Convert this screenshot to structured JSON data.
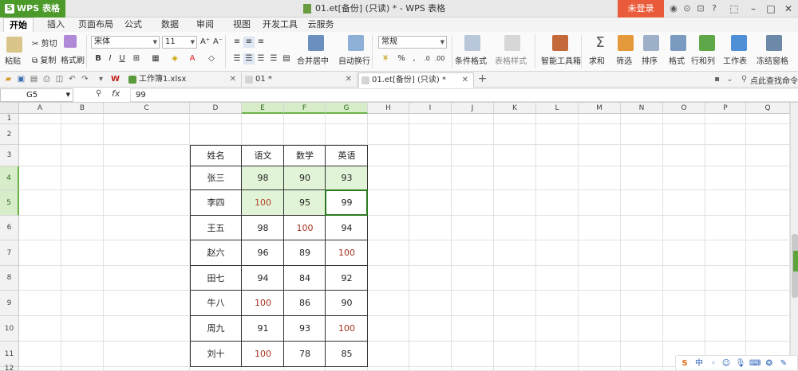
{
  "titlebar": {
    "app_name": "WPS 表格",
    "document_title": "01.et[备份] (只读) * - WPS 表格",
    "login_label": "未登录"
  },
  "menu_tabs": [
    "开始",
    "插入",
    "页面布局",
    "公式",
    "数据",
    "审阅",
    "视图",
    "开发工具",
    "云服务"
  ],
  "ribbon": {
    "cut": "剪切",
    "copy": "复制",
    "format_painter": "格式刷",
    "paste": "粘贴",
    "font_name": "宋体",
    "font_size": "11",
    "bold": "B",
    "italic": "I",
    "underline": "U",
    "merge_center": "合并居中",
    "wrap_text": "自动换行",
    "number_format": "常规",
    "percent": "%",
    "thousands": ",",
    "cond_format": "条件格式",
    "table_style": "表格样式",
    "smart_toolbox": "智能工具箱",
    "sum": "求和",
    "filter": "筛选",
    "sort": "排序",
    "format": "格式",
    "row_col": "行和列",
    "worksheet": "工作表",
    "freeze": "冻结窗格"
  },
  "doc_tabs": [
    {
      "label": "工作簿1.xlsx",
      "active": false
    },
    {
      "label": "01 *",
      "active": false
    },
    {
      "label": "01.et[备份] (只读) *",
      "active": true
    }
  ],
  "find_command": "点此查找命令",
  "formula_bar": {
    "cell_ref": "G5",
    "fx": "fx",
    "value": "99"
  },
  "columns": [
    "A",
    "B",
    "C",
    "D",
    "E",
    "F",
    "G",
    "H",
    "I",
    "J",
    "K",
    "L",
    "M",
    "N",
    "O",
    "P",
    "Q"
  ],
  "rows": [
    "1",
    "2",
    "3",
    "4",
    "5",
    "6",
    "7",
    "8",
    "9",
    "10",
    "11",
    "12"
  ],
  "table": {
    "headers": [
      "姓名",
      "语文",
      "数学",
      "英语"
    ],
    "records": [
      {
        "name": "张三",
        "chinese": "98",
        "math": "90",
        "english": "93"
      },
      {
        "name": "李四",
        "chinese": "100",
        "math": "95",
        "english": "99"
      },
      {
        "name": "王五",
        "chinese": "98",
        "math": "100",
        "english": "94"
      },
      {
        "name": "赵六",
        "chinese": "96",
        "math": "89",
        "english": "100"
      },
      {
        "name": "田七",
        "chinese": "94",
        "math": "84",
        "english": "92"
      },
      {
        "name": "牛八",
        "chinese": "100",
        "math": "86",
        "english": "90"
      },
      {
        "name": "周九",
        "chinese": "91",
        "math": "93",
        "english": "100"
      },
      {
        "name": "刘十",
        "chinese": "100",
        "math": "78",
        "english": "85"
      }
    ]
  },
  "colors": {
    "app_green": "#4c9a2a",
    "login_red": "#e95b3a",
    "highlight_fill": "#e2f4d8",
    "score_100_text": "#a3301e"
  },
  "tray": {
    "ime": "中"
  }
}
